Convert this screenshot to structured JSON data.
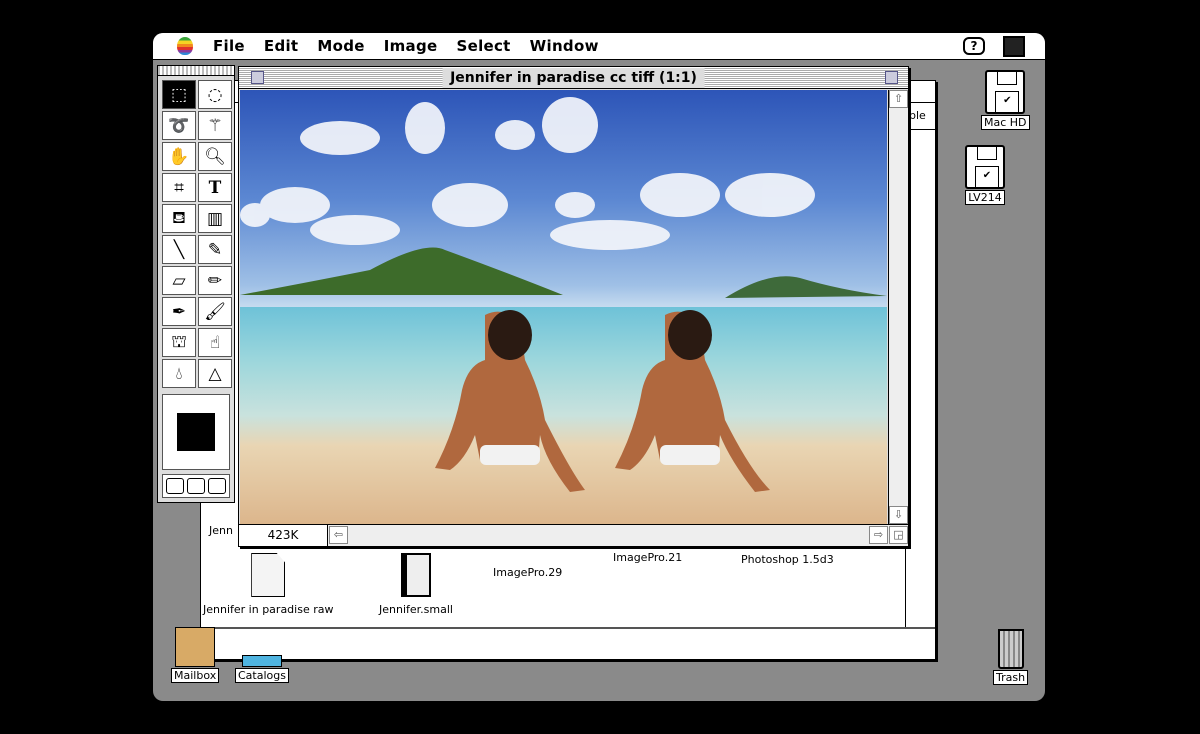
{
  "menubar": {
    "items": [
      "File",
      "Edit",
      "Mode",
      "Image",
      "Select",
      "Window"
    ],
    "help_icon": "?"
  },
  "finder": {
    "partial_label": "ble",
    "partial_name": "Jenn",
    "icons": [
      {
        "name": "Jennifer in paradise raw",
        "icon": "document-icon"
      },
      {
        "name": "Jennifer.small",
        "icon": "film-icon"
      },
      {
        "name": "ImagePro.29",
        "icon": "app-icon"
      },
      {
        "name": "ImagePro.21",
        "icon": "app-icon"
      },
      {
        "name": "Photoshop 1.5d3",
        "icon": "app-icon"
      }
    ]
  },
  "document": {
    "title": "Jennifer in paradise cc tiff  (1:1)",
    "size": "423K"
  },
  "tools": [
    "rect-marquee",
    "ellipse-marquee",
    "lasso",
    "magic-wand",
    "hand",
    "zoom",
    "crop",
    "type",
    "paint-bucket",
    "gradient",
    "line",
    "eyedropper",
    "eraser",
    "pencil",
    "airbrush",
    "paintbrush",
    "rubber-stamp",
    "smudge",
    "blur",
    "sharpen"
  ],
  "desktop": {
    "disks": [
      "Mac HD",
      "LV214"
    ],
    "trash": "Trash",
    "mailbox": "Mailbox",
    "catalogs": "Catalogs"
  },
  "colors": {
    "desktop": "#8a8a8a",
    "foreground": "#000000"
  }
}
